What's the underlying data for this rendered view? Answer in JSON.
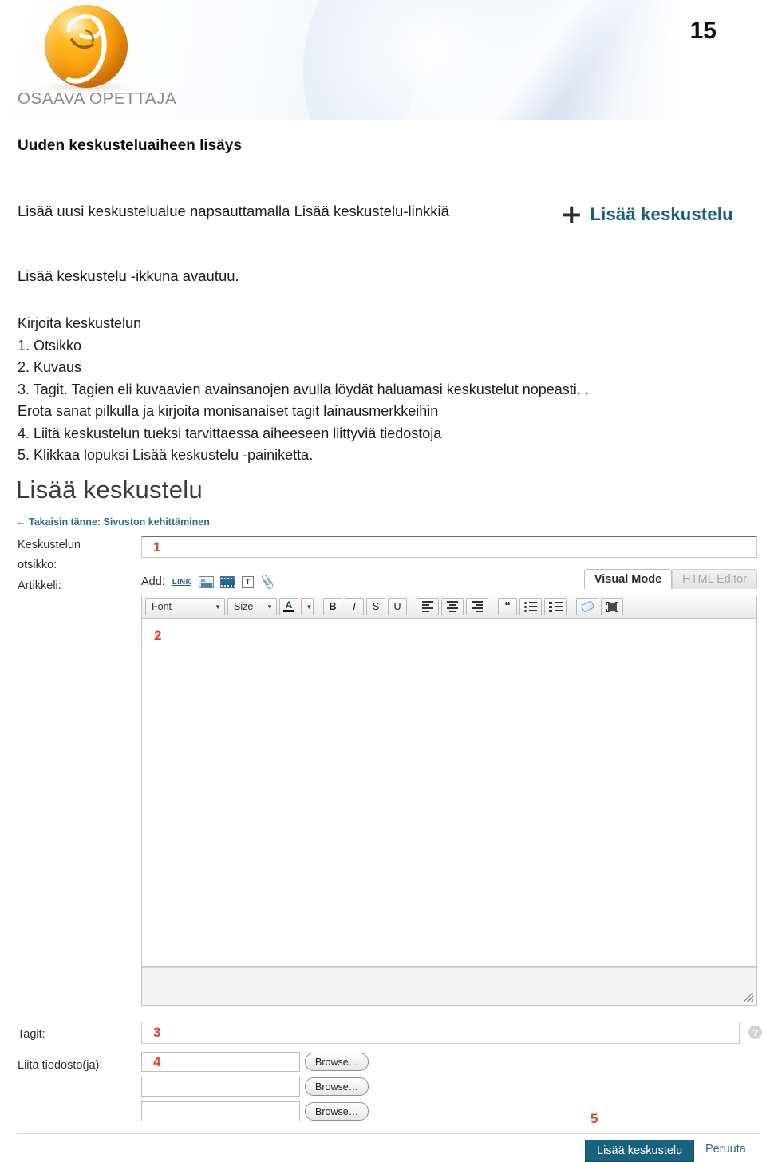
{
  "header": {
    "page_number": "15",
    "logo_text": "OSAAVA OPETTAJA"
  },
  "document": {
    "title": "Uuden keskusteluaiheen lisäys",
    "paragraph_1": "Lisää uusi keskustelualue napsauttamalla Lisää keskustelu-linkkiä",
    "paragraph_2": "Lisää keskustelu -ikkuna avautuu.",
    "list_intro": "Kirjoita keskustelun",
    "list_items": [
      "1. Otsikko",
      "2. Kuvaus",
      "3. Tagit. Tagien eli kuvaavien avainsanojen avulla löydät haluamasi keskustelut nopeasti. .",
      "Erota sanat pilkulla ja kirjoita monisanaiset tagit lainausmerkkeihin",
      "4. Liitä keskustelun tueksi tarvittaessa aiheeseen liittyviä tiedostoja",
      "5. Klikkaa lopuksi Lisää keskustelu -painiketta."
    ],
    "callout_link": {
      "plus": "+",
      "label": "Lisää keskustelu"
    }
  },
  "screenshot": {
    "title": "Lisää keskustelu",
    "breadcrumb": {
      "arrow": "←",
      "text": "Takaisin tänne: Sivuston kehittäminen"
    },
    "fields": {
      "title_label_line1": "Keskustelun",
      "title_label_line2": "otsikko:",
      "title_value": "1",
      "article_label": "Artikkeli:",
      "article_value": "2",
      "tags_label": "Tagit:",
      "tags_value": "3",
      "attach_label": "Liitä tiedosto(ja):",
      "attach_value_1": "4",
      "attach_value_2": "",
      "attach_value_3": "",
      "browse_label": "Browse…",
      "help_icon": "?"
    },
    "editor": {
      "add_label": "Add:",
      "add_icons": [
        "link-icon",
        "image-icon",
        "video-icon",
        "textbox-icon",
        "paperclip-icon"
      ],
      "link_icon_text": "LINK",
      "textbox_icon_text": "T",
      "tabs": [
        {
          "label": "Visual Mode",
          "active": true
        },
        {
          "label": "HTML Editor",
          "active": false
        }
      ],
      "toolbar": {
        "font_select": "Font",
        "size_select": "Size",
        "text_color": "A",
        "bold": "B",
        "italic": "I",
        "strikethrough": "S",
        "underline": "U",
        "quote": "“"
      }
    },
    "footer": {
      "marker": "5",
      "submit_label": "Lisää keskustelu",
      "cancel_label": "Peruuta"
    }
  },
  "colors": {
    "accent_teal": "#18617f",
    "marker_red": "#e0452a",
    "logo_orange": "#f79c0b"
  }
}
